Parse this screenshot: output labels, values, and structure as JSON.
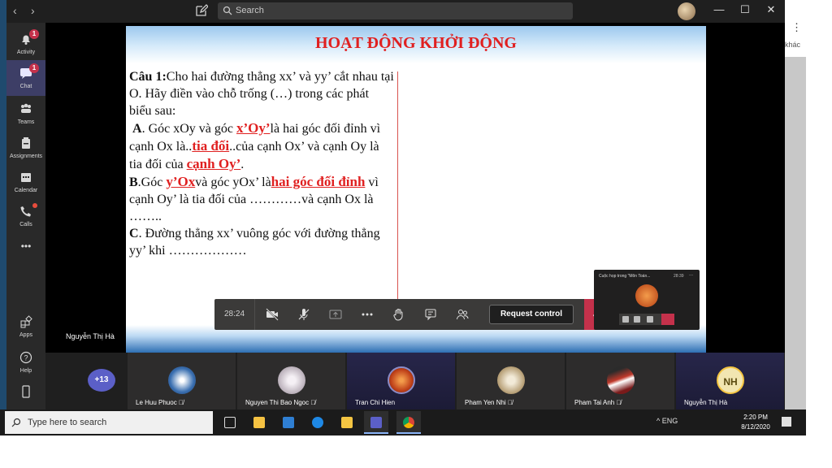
{
  "titlebar": {
    "search_placeholder": "Search",
    "nav_back": "‹",
    "nav_forward": "›",
    "win_min": "—",
    "win_max": "☐",
    "win_close": "✕"
  },
  "right_strip": {
    "dots": "⋮",
    "text": "khác"
  },
  "rail": {
    "items": [
      {
        "label": "Activity",
        "badge": "1",
        "icon": "bell-icon"
      },
      {
        "label": "Chat",
        "badge": "1",
        "icon": "chat-icon"
      },
      {
        "label": "Teams",
        "icon": "teams-icon"
      },
      {
        "label": "Assignments",
        "icon": "assignments-icon"
      },
      {
        "label": "Calendar",
        "icon": "calendar-icon"
      },
      {
        "label": "Calls",
        "icon": "phone-icon"
      },
      {
        "label": "Apps",
        "icon": "apps-icon"
      },
      {
        "label": "Help",
        "icon": "help-icon"
      }
    ],
    "more": "•••"
  },
  "slide": {
    "title": "HOẠT ĐỘNG KHỞI ĐỘNG",
    "q_label": "Câu 1:",
    "q_text": "Cho hai đường thẳng xx’ và yy’ cắt nhau tại O. Hãy điền vào chỗ trống (…) trong các phát biểu sau:",
    "a_label": "A",
    "a_text_1": ". Góc xOy và góc ",
    "a_ans_1": "x’Oy’",
    "a_text_2": "là hai góc đối đỉnh vì cạnh Ox là..",
    "a_ans_2": "tia đối",
    "a_text_3": "..của cạnh Ox’ và cạnh Oy là  tia đối của ",
    "a_ans_3": "cạnh Oy’",
    "a_text_4": ".",
    "b_label": "B",
    "b_text_1": ".Góc ",
    "b_ans_1": "y’Ox",
    "b_text_2": "và góc yOx’ là",
    "b_ans_2": "hai góc đối đỉnh",
    "b_text_3": " vì cạnh Oy’ là tia đối của …………và  cạnh Ox là ……..",
    "c_label": "C",
    "c_text": ". Đường thẳng xx’ vuông góc với đường thẳng yy’ khi ………………"
  },
  "stage": {
    "presenter_name": "Nguyễn Thị Hà"
  },
  "controls": {
    "timer": "28:24",
    "request_control": "Request control"
  },
  "mini": {
    "title": "Cuộc họp trong \"Môn Toán...",
    "time": "28:39",
    "more": "..."
  },
  "participants": {
    "more_count": "+13",
    "tiles": [
      {
        "name": "Le Huu Phuoc",
        "avatar_color": "#3a6fb0"
      },
      {
        "name": "Nguyen Thi Bao Ngoc",
        "avatar_color": "#d8d0d8"
      },
      {
        "name": "Tran Chi Hien",
        "avatar_color": "#c0421a"
      },
      {
        "name": "Pham Yen Nhi",
        "avatar_color": "#b9a27a"
      },
      {
        "name": "Pham Tai Anh",
        "avatar_color": "#7a1a1a"
      },
      {
        "name": "Nguyễn Thị Hà",
        "initials": "NH"
      }
    ]
  },
  "taskbar": {
    "search_placeholder": "Type here to search",
    "tray_text": "^  ENG",
    "clock_time": "2:20 PM",
    "clock_date": "8/12/2020"
  },
  "colors": {
    "accent": "#5b5fc7",
    "hangup": "#c4314b",
    "slide_title": "#e02020"
  }
}
